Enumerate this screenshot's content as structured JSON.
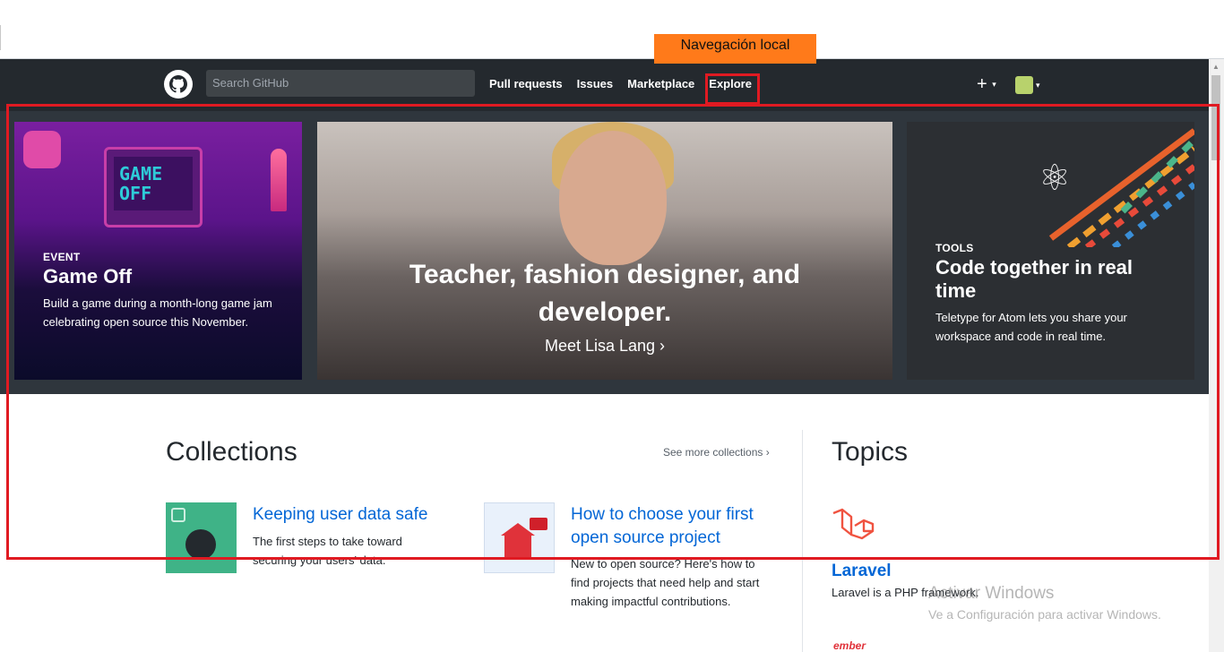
{
  "annotation": {
    "label": "Navegación local"
  },
  "header": {
    "search_placeholder": "Search GitHub",
    "nav": [
      "Pull requests",
      "Issues",
      "Marketplace",
      "Explore"
    ],
    "plus": "+",
    "caret": "▾"
  },
  "hero": {
    "left": {
      "kicker": "EVENT",
      "title": "Game Off",
      "desc": "Build a game during a month-long game jam celebrating open source this November.",
      "screen_text": "GAME OFF"
    },
    "center": {
      "title": "Teacher, fashion designer, and developer.",
      "link": "Meet Lisa Lang ›"
    },
    "right": {
      "kicker": "TOOLS",
      "title": "Code together in real time",
      "desc": "Teletype for Atom lets you share your workspace and code in real time."
    }
  },
  "collections": {
    "heading": "Collections",
    "see_more": "See more collections ›",
    "items": [
      {
        "title": "Keeping user data safe",
        "desc": "The first steps to take toward securing your users' data."
      },
      {
        "title": "How to choose your first open source project",
        "desc": "New to open source? Here's how to find projects that need help and start making impactful contributions."
      }
    ]
  },
  "topics": {
    "heading": "Topics",
    "items": [
      {
        "name": "Laravel",
        "desc": "Laravel is a PHP framework."
      }
    ],
    "next_partial": "ember"
  },
  "watermark": {
    "line1": "Activar Windows",
    "line2": "Ve a Configuración para activar Windows."
  },
  "colors": {
    "header_bg": "#24292e",
    "highlight_red": "#e01a22",
    "annotation_orange": "#ff7a1a",
    "link_blue": "#0366d6"
  }
}
